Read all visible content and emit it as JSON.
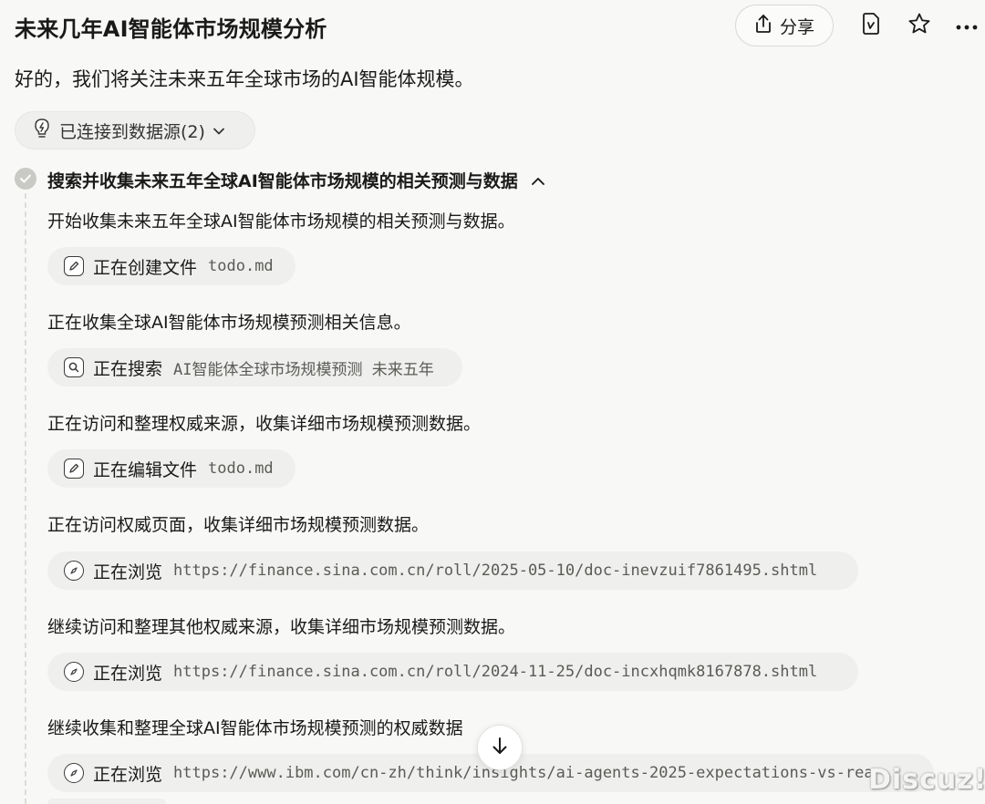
{
  "header": {
    "title": "未来几年AI智能体市场规模分析",
    "share_label": "分享"
  },
  "intro": "好的，我们将关注未来五年全球市场的AI智能体规模。",
  "source_pill": "已连接到数据源(2)",
  "step": {
    "title": "搜索并收集未来五年全球AI智能体市场规模的相关预测与数据",
    "lines": [
      "开始收集未来五年全球AI智能体市场规模的相关预测与数据。",
      "正在收集全球AI智能体市场规模预测相关信息。",
      "正在访问和整理权威来源，收集详细市场规模预测数据。",
      "正在访问权威页面，收集详细市场规模预测数据。",
      "继续访问和整理其他权威来源，收集详细市场规模预测数据。",
      "继续收集和整理全球AI智能体市场规模预测的权威数据"
    ],
    "actions": [
      {
        "verb": "正在创建文件",
        "arg": "todo.md",
        "icon": "edit-icon"
      },
      {
        "verb": "正在搜索",
        "arg": "AI智能体全球市场规模预测 未来五年",
        "icon": "search-icon"
      },
      {
        "verb": "正在编辑文件",
        "arg": "todo.md",
        "icon": "edit-icon"
      },
      {
        "verb": "正在浏览",
        "arg": "https://finance.sina.com.cn/roll/2025-05-10/doc-inevzuif7861495.shtml",
        "icon": "compass-icon"
      },
      {
        "verb": "正在浏览",
        "arg": "https://finance.sina.com.cn/roll/2024-11-25/doc-incxhqmk8167878.shtml",
        "icon": "compass-icon"
      },
      {
        "verb": "正在浏览",
        "arg": "https://www.ibm.com/cn-zh/think/insights/ai-agents-2025-expectations-vs-rea",
        "icon": "compass-icon"
      }
    ]
  },
  "watermark": "Discuz!"
}
